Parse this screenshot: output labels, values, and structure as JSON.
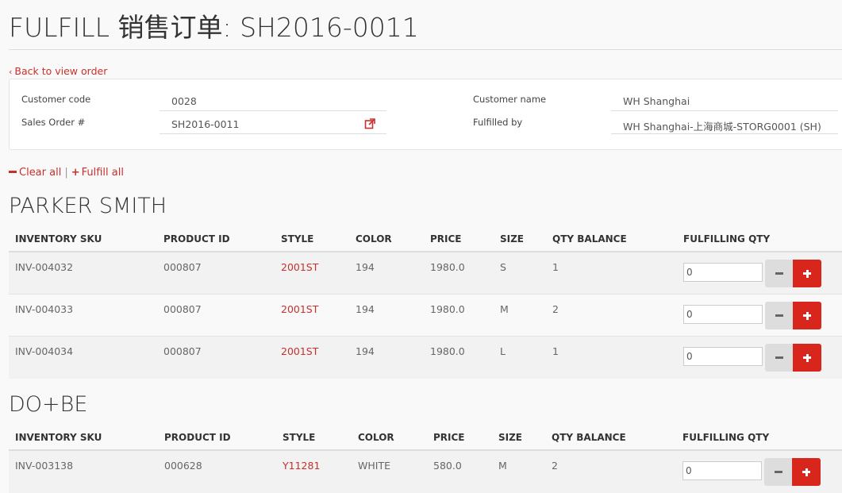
{
  "page_title": "FULFILL 销售订单: SH2016-0011",
  "back_link": "Back to view order",
  "info": {
    "customer_code_label": "Customer code",
    "customer_code": "0028",
    "sales_order_label": "Sales Order #",
    "sales_order": "SH2016-0011",
    "customer_name_label": "Customer name",
    "customer_name": "WH Shanghai",
    "fulfilled_by_label": "Fulfilled by",
    "fulfilled_by": "WH Shanghai-上海商城-STORG0001 (SH)"
  },
  "actions": {
    "clear_all": "Clear all",
    "separator": "|",
    "fulfill_all": "Fulfill all"
  },
  "columns": [
    "INVENTORY SKU",
    "PRODUCT ID",
    "STYLE",
    "COLOR",
    "PRICE",
    "SIZE",
    "QTY BALANCE",
    "FULFILLING QTY"
  ],
  "sections": [
    {
      "title": "PARKER SMITH",
      "rows": [
        {
          "sku": "INV-004032",
          "product_id": "000807",
          "style": "2001ST",
          "color": "194",
          "price": "1980.0",
          "size": "S",
          "qty_balance": "1",
          "fulfilling_qty": "0"
        },
        {
          "sku": "INV-004033",
          "product_id": "000807",
          "style": "2001ST",
          "color": "194",
          "price": "1980.0",
          "size": "M",
          "qty_balance": "2",
          "fulfilling_qty": "0"
        },
        {
          "sku": "INV-004034",
          "product_id": "000807",
          "style": "2001ST",
          "color": "194",
          "price": "1980.0",
          "size": "L",
          "qty_balance": "1",
          "fulfilling_qty": "0"
        }
      ]
    },
    {
      "title": "DO+BE",
      "rows": [
        {
          "sku": "INV-003138",
          "product_id": "000628",
          "style": "Y11281",
          "color": "WHITE",
          "price": "580.0",
          "size": "M",
          "qty_balance": "2",
          "fulfilling_qty": "0"
        }
      ]
    }
  ],
  "colors": {
    "accent": "#c9302c",
    "plus_button": "#d9261c",
    "minus_button": "#dddddd"
  },
  "icons": {
    "back": "chevron-left-icon",
    "external": "external-link-icon",
    "clear": "minus-icon",
    "fulfill": "plus-icon"
  }
}
